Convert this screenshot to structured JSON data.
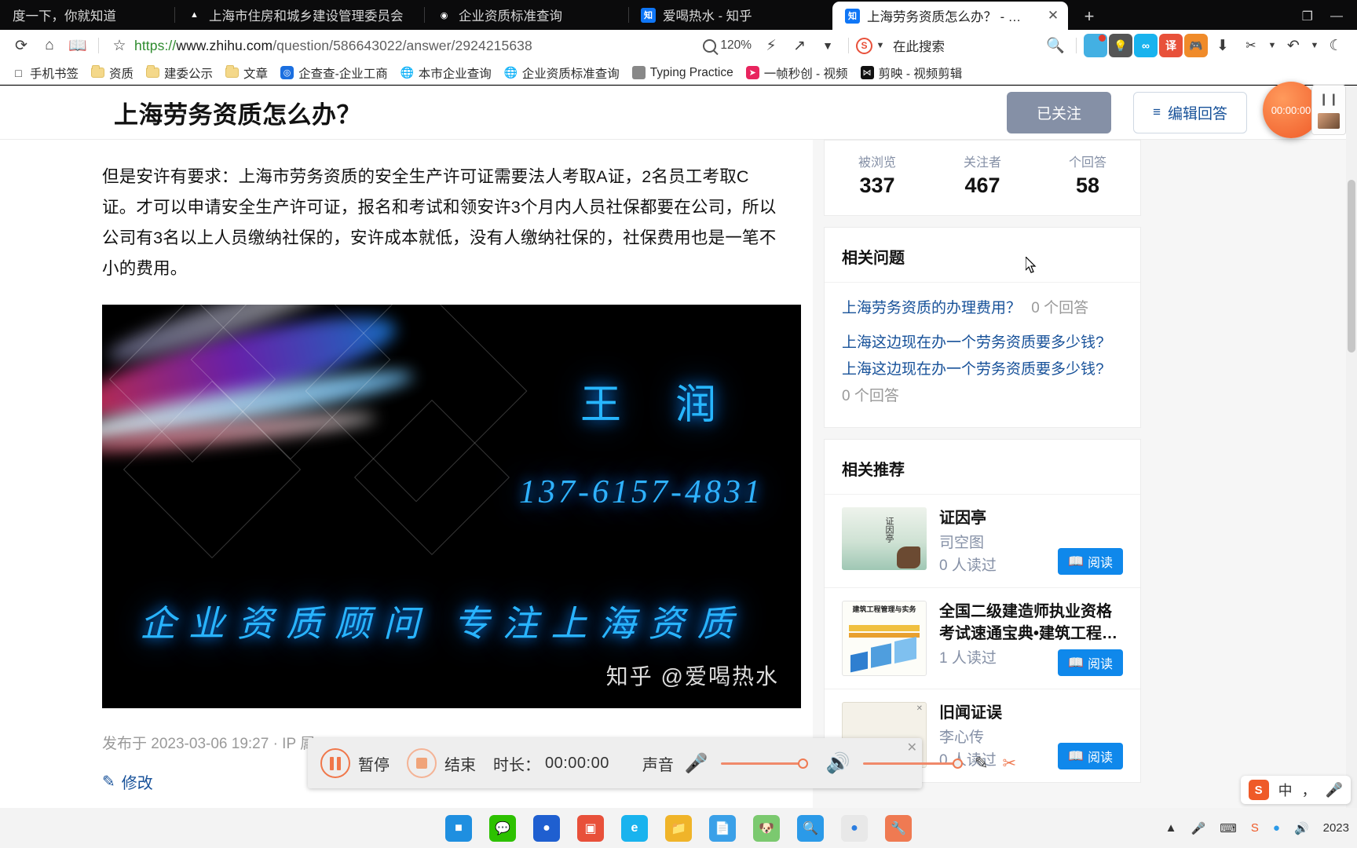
{
  "browser": {
    "tabs": [
      {
        "title": "度一下，你就知道",
        "favicon": "baidu-icon",
        "active": false
      },
      {
        "title": "上海市住房和城乡建设管理委员会",
        "favicon": "gov-icon",
        "active": false
      },
      {
        "title": "企业资质标准查询",
        "favicon": "globe-icon",
        "active": false
      },
      {
        "title": "爱喝热水 - 知乎",
        "favicon": "zhihu-icon",
        "active": false
      },
      {
        "title": "上海劳务资质怎么办？ - 知乎",
        "favicon": "zhihu-icon",
        "active": true
      }
    ],
    "new_tab_label": "+",
    "close_label": "✕",
    "window_controls": {
      "restore": "❐",
      "minimize": "—"
    },
    "url": {
      "scheme": "https://",
      "host": "www.zhihu.com",
      "path": "/question/586643022/answer/2924215638",
      "full": "https://www.zhihu.com/question/586643022/answer/2924215638"
    },
    "zoom_level": "120%",
    "search_engine_label": "在此搜索",
    "nav_icons": [
      "reload-icon",
      "home-icon",
      "reader-icon",
      "bookmark-star-icon"
    ],
    "toolbar_icons": [
      "lightning-icon",
      "share-icon",
      "chevron-down-icon",
      "search-icon",
      "wechat-ext-icon",
      "bulb-icon",
      "infinity-icon",
      "translate-icon",
      "game-icon",
      "download-icon",
      "scissors-icon",
      "undo-icon",
      "moon-icon"
    ],
    "bookmarks": [
      {
        "label": "手机书签",
        "icon": "phone-icon"
      },
      {
        "label": "资质",
        "icon": "folder-icon"
      },
      {
        "label": "建委公示",
        "icon": "folder-icon"
      },
      {
        "label": "文章",
        "icon": "folder-icon"
      },
      {
        "label": "企查查-企业工商",
        "icon": "qcc-icon"
      },
      {
        "label": "本市企业查询",
        "icon": "globe-icon"
      },
      {
        "label": "企业资质标准查询",
        "icon": "globe-icon"
      },
      {
        "label": "Typing Practice",
        "icon": "typing-icon"
      },
      {
        "label": "一帧秒创 - 视频",
        "icon": "yizhen-icon"
      },
      {
        "label": "剪映 - 视频剪辑",
        "icon": "jianying-icon"
      }
    ]
  },
  "page": {
    "title": "上海劳务资质怎么办？",
    "follow_button": "已关注",
    "edit_button": "编辑回答",
    "edit_icon": "edit-list-icon",
    "answer_paragraph": "但是安许有要求：上海市劳务资质的安全生产许可证需要法人考取A证，2名员工考取C证。才可以申请安全生产许可证，报名和考试和领安许3个月内人员社保都要在公司，所以公司有3名以上人员缴纳社保的，安许成本就低，没有人缴纳社保的，社保费用也是一笔不小的费用。",
    "video": {
      "name": "王 润",
      "phone": "137-6157-4831",
      "slogan": "企业资质顾问 专注上海资质",
      "watermark": "知乎 @爱喝热水"
    },
    "publish_meta": "发布于 2023-03-06 19:27 · IP 属",
    "edit_link": "修改",
    "edit_link_icon": "pencil-icon"
  },
  "sidebar": {
    "stats": [
      {
        "label": "被浏览",
        "value": "337"
      },
      {
        "label": "关注者",
        "value": "467"
      },
      {
        "label": "个回答",
        "value": "58"
      }
    ],
    "related_questions": {
      "title": "相关问题",
      "items": [
        {
          "text": "上海劳务资质的办理费用？",
          "count": "0 个回答"
        },
        {
          "text": "上海这边现在办一个劳务资质要多少钱?",
          "count": ""
        },
        {
          "text": "上海这边现在办一个劳务资质要多少钱?",
          "count": "0 个回答"
        }
      ]
    },
    "recommendations": {
      "title": "相关推荐",
      "read_button": "阅读",
      "read_icon": "book-icon",
      "items": [
        {
          "name": "证因亭",
          "author": "司空图",
          "reads": "0 人读过",
          "cover_title": "证因亭"
        },
        {
          "name": "全国二级建造师执业资格考试速通宝典•建筑工程管…",
          "author": "",
          "reads": "1 人读过",
          "cover_title": "建筑工程管理与实务"
        },
        {
          "name": "旧闻证误",
          "author": "李心传",
          "reads": "0 人读过",
          "cover_title": ""
        }
      ]
    }
  },
  "recorder": {
    "pause_label": "暂停",
    "stop_label": "结束",
    "duration_label": "时长：",
    "duration_value": "00:00:00",
    "sound_label": "声音",
    "mic_icon": "microphone-icon",
    "speaker_icon": "speaker-icon",
    "pen_icon": "pencil-icon",
    "cut_icon": "scissors-icon",
    "close_icon": "close-icon",
    "pause_icon": "pause-icon",
    "stop_icon": "stop-icon",
    "float_timer": "00:00:00"
  },
  "taskbar": {
    "icons": [
      "start-icon",
      "wechat-icon",
      "browser-icon",
      "store-icon",
      "edge-dev-icon",
      "explorer-icon",
      "notes-icon",
      "qq-icon",
      "search-ball-icon",
      "chrome-icon",
      "tool-icon"
    ],
    "tray": [
      "chevron-up-icon",
      "microphone-icon",
      "ime-icon",
      "sogou-icon",
      "wifi-icon",
      "volume-icon",
      "clock-icon"
    ],
    "date": "2023"
  },
  "ime": {
    "mode": "中",
    "comma": "，",
    "mic": "microphone-icon",
    "logo": "S"
  },
  "colors": {
    "accent_blue": "#175199",
    "follow_gray": "#8590a6",
    "recorder_orange": "#ef7a52",
    "read_button_blue": "#0f88eb"
  }
}
